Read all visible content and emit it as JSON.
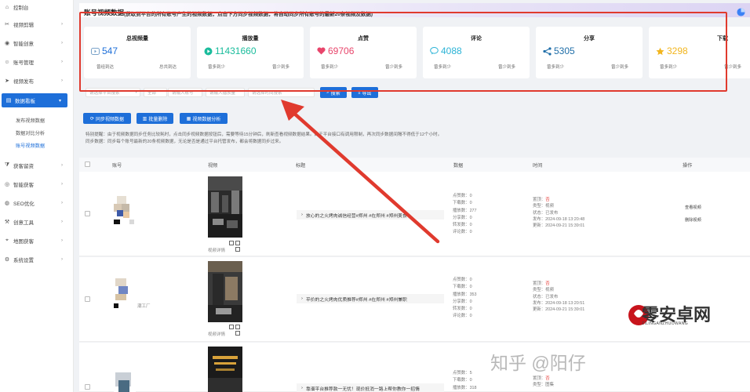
{
  "sidebar": {
    "items": [
      {
        "label": "控制台",
        "icon": "home-icon"
      },
      {
        "label": "视频剪辑",
        "icon": "scissors-icon"
      },
      {
        "label": "智能创意",
        "icon": "bulb-icon"
      },
      {
        "label": "账号管理",
        "icon": "user-icon"
      },
      {
        "label": "视频发布",
        "icon": "send-icon"
      },
      {
        "label": "数据看板",
        "icon": "chart-icon"
      },
      {
        "label": "获客留资",
        "icon": "funnel-icon"
      },
      {
        "label": "智能获客",
        "icon": "target-icon"
      },
      {
        "label": "SEO优化",
        "icon": "seo-icon"
      },
      {
        "label": "创意工具",
        "icon": "tool-icon"
      },
      {
        "label": "地图获客",
        "icon": "map-icon"
      },
      {
        "label": "系统设置",
        "icon": "gear-icon"
      }
    ],
    "sub_items": [
      {
        "label": "发布视频数据"
      },
      {
        "label": "数据对比分析"
      },
      {
        "label": "账号视频数据"
      }
    ]
  },
  "header": {
    "title": "账号视频数据",
    "subtitle": "(获取到平台的所有账号产生的视频数据，点击下方同步视频数据，将自动同步所有账号的最新20条视频及数据)"
  },
  "stats": [
    {
      "title": "总视频量",
      "value": "547",
      "icon": "video-icon",
      "color": "#7aa3c9",
      "foot_left": "曾经到达",
      "foot_right": "总共到达"
    },
    {
      "title": "播放量",
      "value": "11431660",
      "icon": "play-icon",
      "color": "#1abc9c",
      "foot_left": "曾多到少",
      "foot_right": "曾少到多"
    },
    {
      "title": "点赞",
      "value": "69706",
      "icon": "heart-icon",
      "color": "#e8456b",
      "foot_left": "曾多到少",
      "foot_right": "曾少到多"
    },
    {
      "title": "评论",
      "value": "4088",
      "icon": "comment-icon",
      "color": "#2bb3d6",
      "foot_left": "曾多到少",
      "foot_right": "曾少到多"
    },
    {
      "title": "分享",
      "value": "5305",
      "icon": "share-icon",
      "color": "#1f6ea8",
      "foot_left": "曾多到少",
      "foot_right": "曾少到多"
    },
    {
      "title": "下载",
      "value": "3298",
      "icon": "star-icon",
      "color": "#f2b51e",
      "foot_left": "曾多到少",
      "foot_right": "曾少到多"
    }
  ],
  "filters": {
    "platform": "请选择平台搜索",
    "level": "全部",
    "account": "请输入账号",
    "play_count": "请输入播放量",
    "time": "请选择时间搜索",
    "search_label": "搜索",
    "export_label": "导出"
  },
  "actions": {
    "sync_label": "同步视频数据",
    "batch_delete_label": "批量删除",
    "analysis_label": "视频数据分析"
  },
  "notice": {
    "line1": "特别提醒：由于视频数据同步任务比较耗时，点击同步视频数据按钮后，需要等待15分钟后，刷新查看视频数据结果。由于平台接口有调用限制，再次同步数据间隔不得低于12个小时。",
    "line2": "同步数据：同步每个账号最新的20条视频数据，无论是否是通过平台托管发布，都会将数据同步过来。"
  },
  "table": {
    "headers": [
      "账号",
      "视频",
      "标题",
      "数据",
      "时间",
      "操作"
    ],
    "rows": [
      {
        "account": "",
        "video_label": "视频详情",
        "title": "放心的之火烤肉诚信经营#郑州 #在郑州 #郑州美食",
        "data": [
          "点赞数：0",
          "下载数：0",
          "播放数：277",
          "分享数：0",
          "转发数：0",
          "评论数：0"
        ],
        "time": {
          "status_label": "置顶：",
          "status_value": "否",
          "type": "类型：视频",
          "state": "状态：已发布",
          "published": "发布：2024-09-18 13:20:48",
          "updated": "更新：2024-09-21 15:39:01"
        },
        "ops": [
          "查看视频",
          "删除视频"
        ]
      },
      {
        "account": "潮工厂",
        "video_label": "视频详情",
        "title": "平价的之火烤肉优质推荐#郑州 #在郑州 #郑州兼职",
        "data": [
          "点赞数：0",
          "下载数：0",
          "播放数：353",
          "分享数：0",
          "转发数：0",
          "评论数：0"
        ],
        "time": {
          "status_label": "置顶：",
          "status_value": "否",
          "type": "类型：视频",
          "state": "状态：已发布",
          "published": "发布：2024-09-18 13:20:51",
          "updated": "更新：2024-09-21 15:39:01"
        },
        "ops": []
      },
      {
        "account": "",
        "video_label": "",
        "title": "靠谱平台推荐款一无忧！现价抵消一路上帮你教你一招情",
        "data": [
          "点赞数：5",
          "下载数：0",
          "播放数：318"
        ],
        "time": {
          "status_label": "置顶：",
          "status_value": "否",
          "type": "类型：图集"
        },
        "ops": []
      }
    ]
  },
  "watermarks": {
    "zhihu": "知乎 @阳仔",
    "logo": "零安卓网",
    "logo_sub": "ZILINGANZHUOWANG"
  },
  "colors": {
    "accent": "#1e6fd9",
    "annotation": "#e03a2e"
  }
}
